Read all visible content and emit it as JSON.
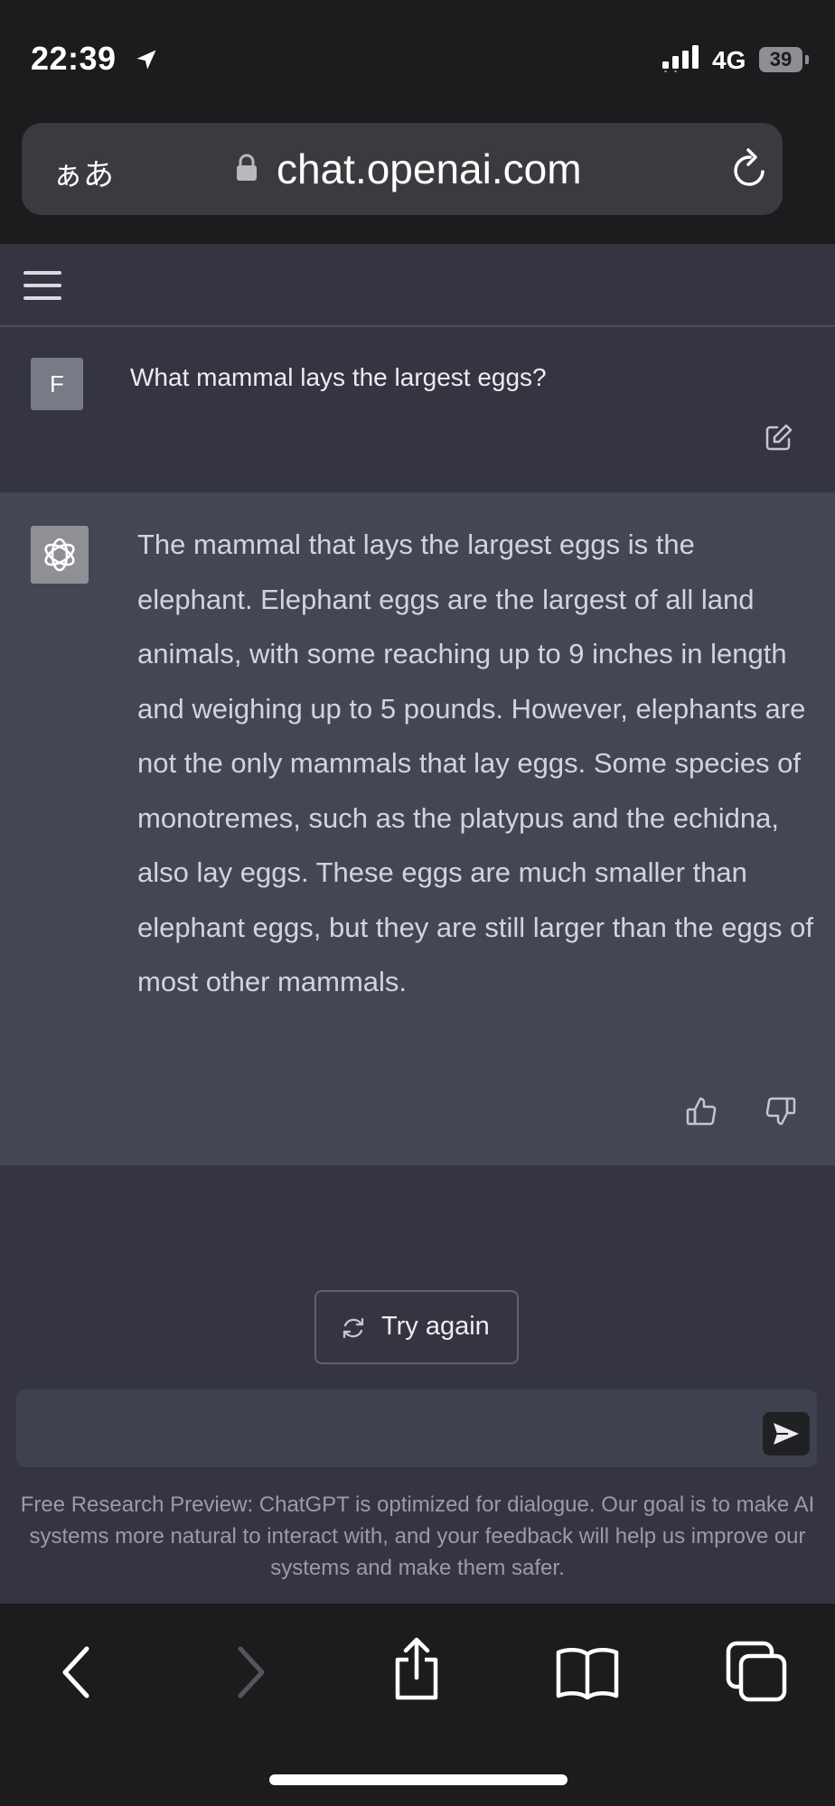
{
  "status_bar": {
    "time": "22:39",
    "network": "4G",
    "battery": "39"
  },
  "browser": {
    "text_size_label": "ぁあ",
    "url": "chat.openai.com"
  },
  "conversation": {
    "user_avatar_letter": "F",
    "user_message": "What mammal lays the largest eggs?",
    "assistant_message": "The mammal that lays the largest eggs is the elephant. Elephant eggs are the largest of all land animals, with some reaching up to 9 inches in length and weighing up to 5 pounds. However, elephants are not the only mammals that lay eggs. Some species of monotremes, such as the platypus and the echidna, also lay eggs. These eggs are much smaller than elephant eggs, but they are still larger than the eggs of most other mammals."
  },
  "actions": {
    "try_again_label": "Try again"
  },
  "composer": {
    "value": ""
  },
  "footer": {
    "note": "Free Research Preview: ChatGPT is optimized for dialogue. Our goal is to make AI systems more natural to interact with, and your feedback will help us improve our systems and make them safer."
  },
  "colors": {
    "page_bg": "#343541",
    "assistant_bg": "#444654",
    "input_bg": "#40414f",
    "chrome_bg": "#1c1c1f"
  },
  "icons": [
    "location-arrow-icon",
    "signal-icon",
    "battery-icon",
    "lock-icon",
    "reload-icon",
    "menu-icon",
    "edit-icon",
    "openai-logo-icon",
    "thumbs-up-icon",
    "thumbs-down-icon",
    "refresh-icon",
    "send-icon",
    "back-icon",
    "forward-icon",
    "share-icon",
    "bookmarks-icon",
    "tabs-icon"
  ]
}
